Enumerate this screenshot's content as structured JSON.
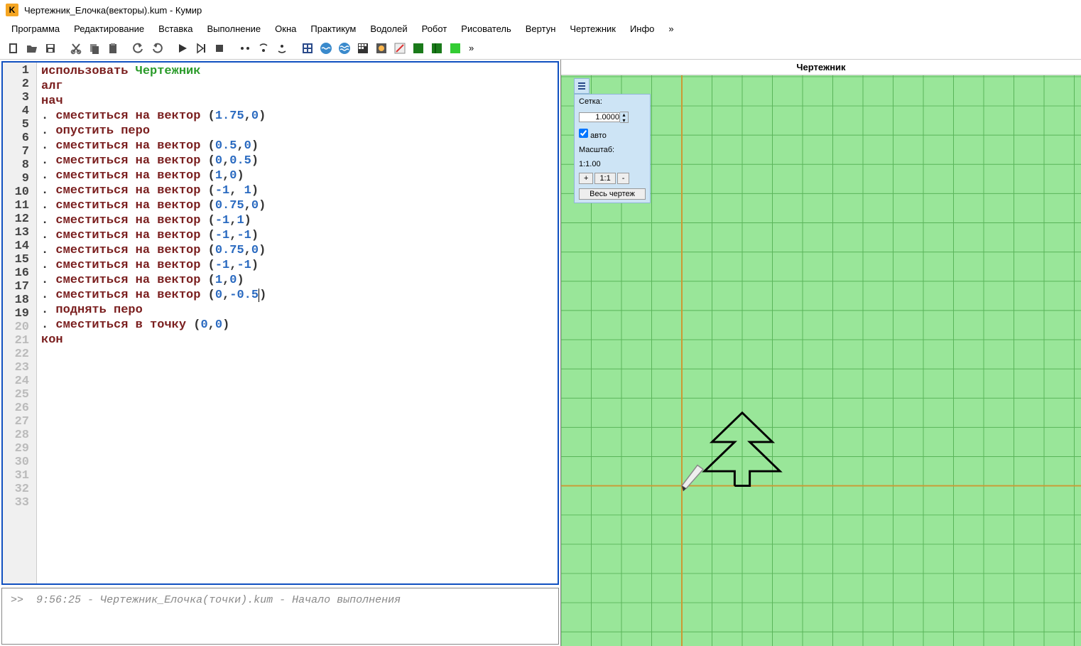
{
  "window": {
    "title": "Чертежник_Елочка(векторы).kum - Кумир"
  },
  "menu": {
    "items": [
      "Программа",
      "Редактирование",
      "Вставка",
      "Выполнение",
      "Окна",
      "Практикум",
      "Водолей",
      "Робот",
      "Рисователь",
      "Вертун",
      "Чертежник",
      "Инфо",
      "»"
    ]
  },
  "code": {
    "lines": [
      {
        "n": 1,
        "type": "use",
        "kw": "использовать",
        "mod": "Чертежник"
      },
      {
        "n": 2,
        "type": "kw",
        "kw": "алг"
      },
      {
        "n": 3,
        "type": "kw",
        "kw": "нач"
      },
      {
        "n": 4,
        "type": "cmd",
        "cmd": "сместиться на вектор",
        "args": [
          "1.75",
          "0"
        ]
      },
      {
        "n": 5,
        "type": "cmd0",
        "cmd": "опустить перо"
      },
      {
        "n": 6,
        "type": "cmd",
        "cmd": "сместиться на вектор",
        "args": [
          "0.5",
          "0"
        ]
      },
      {
        "n": 7,
        "type": "cmd",
        "cmd": "сместиться на вектор",
        "args": [
          "0",
          "0.5"
        ]
      },
      {
        "n": 8,
        "type": "cmd",
        "cmd": "сместиться на вектор",
        "args": [
          "1",
          "0"
        ]
      },
      {
        "n": 9,
        "type": "cmd",
        "cmd": "сместиться на вектор",
        "args": [
          "-1",
          " 1"
        ]
      },
      {
        "n": 10,
        "type": "cmd",
        "cmd": "сместиться на вектор",
        "args": [
          "0.75",
          "0"
        ]
      },
      {
        "n": 11,
        "type": "cmd",
        "cmd": "сместиться на вектор",
        "args": [
          "-1",
          "1"
        ]
      },
      {
        "n": 12,
        "type": "cmd",
        "cmd": "сместиться на вектор",
        "args": [
          "-1",
          "-1"
        ]
      },
      {
        "n": 13,
        "type": "cmd",
        "cmd": "сместиться на вектор",
        "args": [
          "0.75",
          "0"
        ]
      },
      {
        "n": 14,
        "type": "cmd",
        "cmd": "сместиться на вектор",
        "args": [
          "-1",
          "-1"
        ]
      },
      {
        "n": 15,
        "type": "cmd",
        "cmd": "сместиться на вектор",
        "args": [
          "1",
          "0"
        ]
      },
      {
        "n": 16,
        "type": "cmd",
        "cmd": "сместиться на вектор",
        "args": [
          "0",
          "-0.5"
        ],
        "cursor": true
      },
      {
        "n": 17,
        "type": "cmd0",
        "cmd": "поднять перо"
      },
      {
        "n": 18,
        "type": "cmd",
        "cmd": "сместиться в точку",
        "args": [
          "0",
          "0"
        ]
      },
      {
        "n": 19,
        "type": "kw",
        "kw": "кон"
      }
    ],
    "empty_lines": [
      20,
      21,
      22,
      23,
      24,
      25,
      26,
      27,
      28,
      29,
      30,
      31,
      32,
      33
    ]
  },
  "console": {
    "prompt": ">>",
    "time": "9:56:25",
    "file": "Чертежник_Елочка(точки).kum",
    "msg": "Начало выполнения"
  },
  "right": {
    "title": "Чертежник",
    "panel": {
      "grid_label": "Сетка:",
      "grid_value": "1.0000",
      "auto_label": "авто",
      "scale_label": "Масштаб:",
      "scale_value": "1:1.00",
      "plus": "+",
      "oneone": "1:1",
      "minus": "-",
      "fit": "Весь чертеж"
    }
  },
  "chart_data": {
    "type": "line",
    "title": "Чертежник",
    "xlabel": "",
    "ylabel": "",
    "grid": {
      "step": 1
    },
    "origin": [
      0,
      0
    ],
    "axis_range": {
      "x": [
        -4,
        13
      ],
      "y": [
        -6,
        14
      ]
    },
    "series": [
      {
        "name": "Елочка",
        "points": [
          [
            1.75,
            0
          ],
          [
            2.25,
            0
          ],
          [
            2.25,
            0.5
          ],
          [
            3.25,
            0.5
          ],
          [
            2.25,
            1.5
          ],
          [
            3.0,
            1.5
          ],
          [
            2.0,
            2.5
          ],
          [
            1.0,
            1.5
          ],
          [
            1.75,
            1.5
          ],
          [
            0.75,
            0.5
          ],
          [
            1.75,
            0.5
          ],
          [
            1.75,
            0
          ]
        ]
      }
    ],
    "pen_position": [
      0,
      0
    ]
  }
}
